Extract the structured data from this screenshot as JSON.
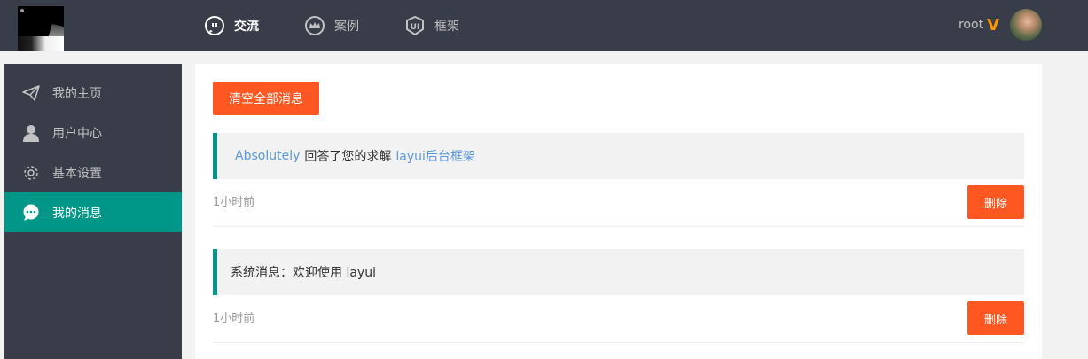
{
  "header": {
    "nav": [
      {
        "label": "交流",
        "icon": "chat-bubble-icon"
      },
      {
        "label": "案例",
        "icon": "crown-badge-icon"
      },
      {
        "label": "框架",
        "icon": "ui-shield-icon"
      }
    ],
    "user": {
      "name": "root",
      "vip": "V"
    }
  },
  "sidebar": {
    "items": [
      {
        "label": "我的主页",
        "icon": "paper-plane-icon"
      },
      {
        "label": "用户中心",
        "icon": "user-icon"
      },
      {
        "label": "基本设置",
        "icon": "gear-icon"
      },
      {
        "label": "我的消息",
        "icon": "message-icon"
      }
    ]
  },
  "main": {
    "clear_label": "清空全部消息",
    "messages": [
      {
        "user": "Absolutely",
        "text": "回答了您的求解",
        "topic": "layui后台框架",
        "time": "1小时前",
        "delete_label": "删除"
      },
      {
        "text": "系统消息：欢迎使用 layui",
        "time": "1小时前",
        "delete_label": "删除"
      }
    ]
  },
  "colors": {
    "header_bg": "#393d49",
    "accent": "#009688",
    "danger": "#FF5722",
    "vip": "#FF9800",
    "link": "#5a98de"
  }
}
